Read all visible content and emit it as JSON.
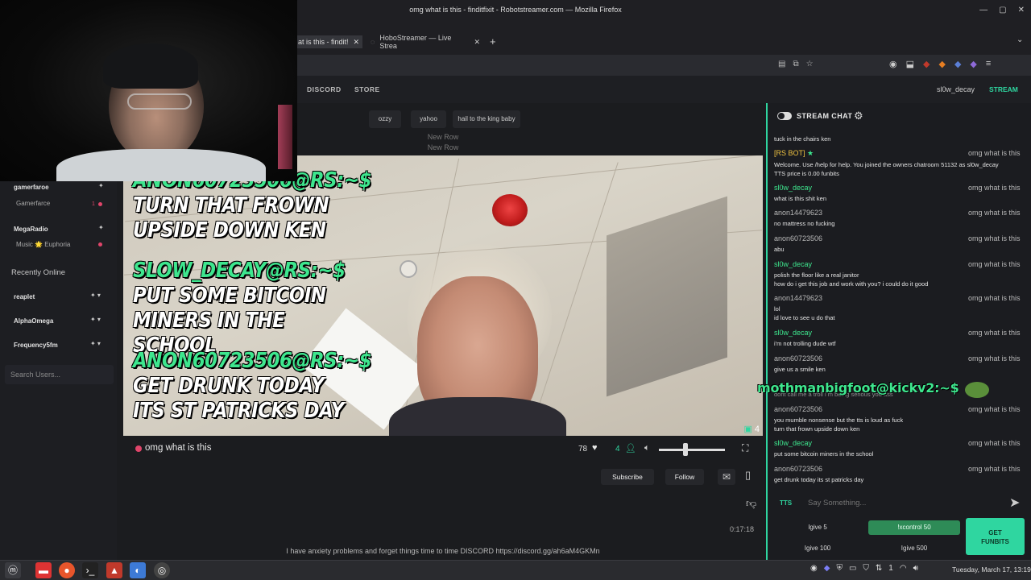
{
  "window": {
    "title": "omg what is this - finditfixit - Robotstreamer.com — Mozilla Firefox"
  },
  "tabs": [
    {
      "label": "at is this - findit!"
    },
    {
      "label": "HoboStreamer — Live Strea"
    }
  ],
  "site_nav": {
    "discord": "DISCORD",
    "store": "STORE",
    "username": "sl0w_decay",
    "stream": "STREAM"
  },
  "quick_buttons": [
    "ozzy",
    "yahoo",
    "hail to the king baby"
  ],
  "new_row_labels": [
    "New Row",
    "New Row"
  ],
  "sidebar": {
    "live_users": [
      {
        "name": "gamerfaroe",
        "sub": "Gamerfarce"
      },
      {
        "name": "MegaRadio",
        "sub": "Music 🌟 Euphoria"
      }
    ],
    "recently_online_title": "Recently Online",
    "recent_users": [
      "reaplet",
      "AlphaOmega",
      "Frequency5fm"
    ],
    "search_placeholder": "Search Users..."
  },
  "video_overlay": {
    "messages": [
      {
        "prefix": "ANON60723506@RS:~$",
        "text": "TURN THAT FROWN UPSIDE DOWN KEN"
      },
      {
        "prefix": "SLOW_DECAY@RS:~$",
        "text": "PUT SOME BITCOIN MINERS IN THE SCHOOL"
      },
      {
        "prefix": "ANON60723506@RS:~$",
        "text": "GET DRUNK TODAY ITS ST PATRICKS DAY"
      }
    ],
    "viewer_badge": "4"
  },
  "player": {
    "stream_title": "omg what is this",
    "likes": "78",
    "viewers": "4",
    "volume_percent": 40,
    "subscribe": "Subscribe",
    "follow": "Follow",
    "elapsed": "0:17:18",
    "description": "I have anxiety problems and forget things time to time DISCORD https://discord.gg/ah6aM4GKMn"
  },
  "chat": {
    "title": "STREAM CHAT",
    "top_fragment": "tuck in the chairs ken",
    "bot": {
      "name": "[RS BOT]",
      "tag": "omg what is this",
      "lines": [
        "Welcome. Use /help for help. You joined the owners chatroom 51132 as sl0w_decay",
        "TTS price is 0.00 funbits"
      ]
    },
    "messages": [
      {
        "name": "sl0w_decay",
        "green": true,
        "tag": "omg what is this",
        "lines": [
          "what is this shit ken"
        ]
      },
      {
        "name": "anon14479623",
        "green": false,
        "tag": "omg what is this",
        "lines": [
          "no mattress no fucking"
        ]
      },
      {
        "name": "anon60723506",
        "green": false,
        "tag": "omg what is this",
        "lines": [
          "abu"
        ]
      },
      {
        "name": "sl0w_decay",
        "green": true,
        "tag": "omg what is this",
        "lines": [
          "polish the floor like a real janitor",
          "how do i get this job and work with you? i could do it good"
        ]
      },
      {
        "name": "anon14479623",
        "green": false,
        "tag": "omg what is this",
        "lines": [
          "lol",
          "id love to see u do that"
        ]
      },
      {
        "name": "sl0w_decay",
        "green": true,
        "tag": "omg what is this",
        "lines": [
          "i'm not trolling dude wtf"
        ]
      },
      {
        "name": "anon60723506",
        "green": false,
        "tag": "omg what is this",
        "lines": [
          "give us a smile ken"
        ]
      },
      {
        "name": "anon60723506",
        "green": false,
        "tag": "omg what is this",
        "lines": [
          "you mumble nonsense but the tts is loud as fuck",
          "turn that frown upside down ken"
        ]
      },
      {
        "name": "sl0w_decay",
        "green": true,
        "tag": "omg what is this",
        "lines": [
          "put some bitcoin miners in the school"
        ]
      },
      {
        "name": "anon60723506",
        "green": false,
        "tag": "omg what is this",
        "lines": [
          "get drunk today its st patricks day"
        ]
      }
    ],
    "hidden_line": "dont call me a troll i m being serious you ass",
    "kick_overlay": "mothmanbigfoot@kickv2:~$",
    "tts_label": "TTS",
    "input_placeholder": "Say Something...",
    "tips": [
      "Igive 5",
      "!xcontrol 50",
      "Igive 100",
      "Igive 500"
    ],
    "get_funbits": [
      "GET",
      "FUNBITS"
    ]
  },
  "taskbar": {
    "clock": "Tuesday, March 17, 13:19",
    "tray_count": "1"
  }
}
